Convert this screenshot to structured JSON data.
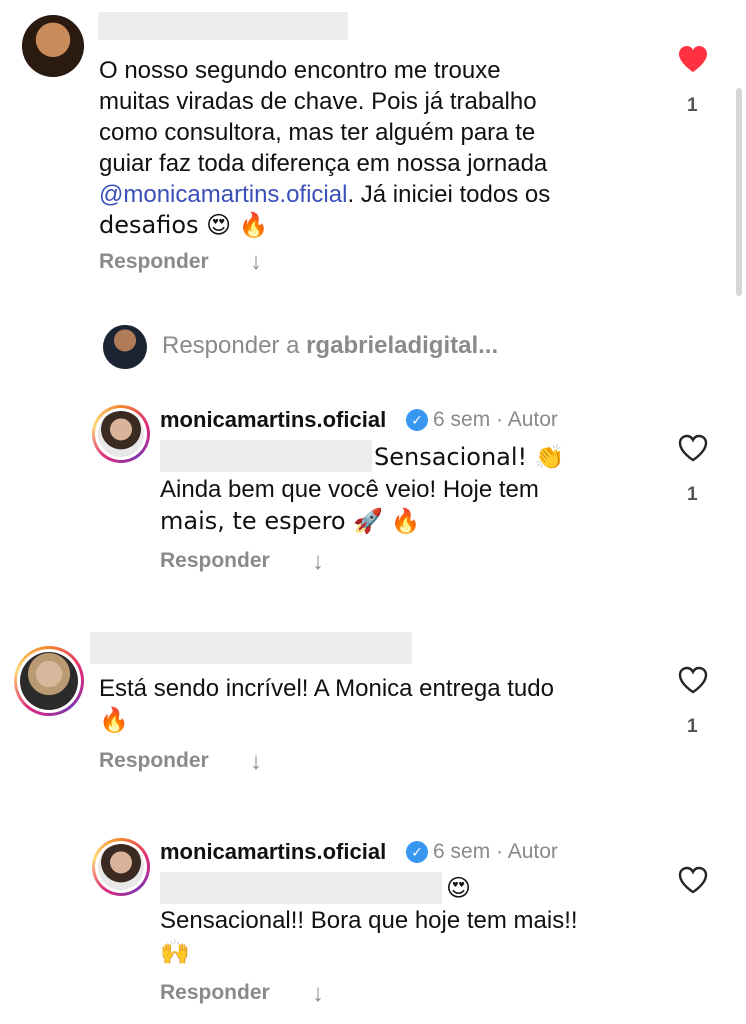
{
  "comments": [
    {
      "text_lines": [
        "O nosso segundo encontro me trouxe",
        "muitas viradas de chave. Pois já trabalho",
        "como consultora, mas ter alguém para te",
        "guiar faz toda diferença em nossa jornada"
      ],
      "mention": "@monicamartins.oficial",
      "after_mention": ". Já iniciei todos os",
      "last_line": "desafios 😍 🔥",
      "likes": "1",
      "reply_label": "Responder",
      "liked": true
    }
  ],
  "reply_box": {
    "prefix": "Responder a ",
    "target": "rgabrieladigital...",
    "color_like": "#ff3040"
  },
  "reply1": {
    "username": "monicamartins.oficial",
    "time": "6 sem",
    "separator": "·",
    "author": "Autor",
    "line1": "Sensacional! 👏",
    "line2": "Ainda bem que você veio! Hoje tem",
    "line3": "mais, te espero 🚀 🔥",
    "likes": "1",
    "reply_label": "Responder"
  },
  "comment2": {
    "line1": "Está sendo incrível! A Monica entrega tudo",
    "line2": "🔥",
    "likes": "1",
    "reply_label": "Responder"
  },
  "reply2": {
    "username": "monicamartins.oficial",
    "time": "6 sem",
    "separator": "·",
    "author": "Autor",
    "line1": "😍",
    "line2": "Sensacional!! Bora que hoje tem mais!!",
    "line3": "🙌",
    "reply_label": "Responder"
  },
  "icons": {
    "heart_filled": "heart-filled-icon",
    "heart_outline": "heart-outline-icon",
    "arrow_down": "arrow-down-icon",
    "verified": "verified-badge-icon"
  }
}
